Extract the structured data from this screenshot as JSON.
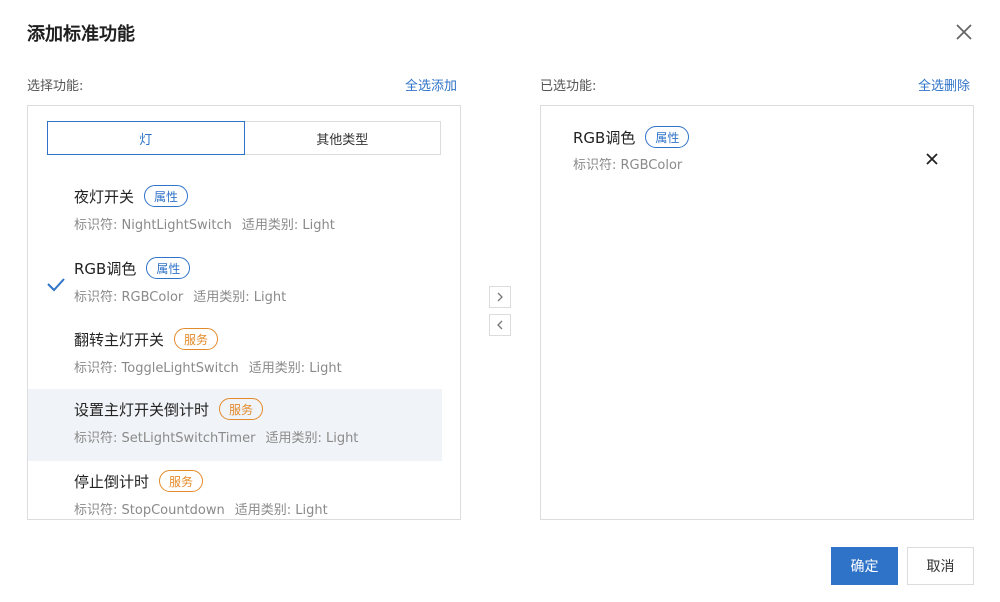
{
  "dialog": {
    "title": "添加标准功能"
  },
  "left": {
    "label": "选择功能:",
    "select_all": "全选添加",
    "tabs": [
      {
        "label": "灯",
        "active": true
      },
      {
        "label": "其他类型",
        "active": false
      }
    ],
    "items": [
      {
        "name": "夜灯开关",
        "badge": "属性",
        "badge_type": "attr",
        "id_label": "标识符: NightLightSwitch",
        "category_label": "适用类别: Light",
        "checked": false,
        "hovered": false
      },
      {
        "name": "RGB调色",
        "badge": "属性",
        "badge_type": "attr",
        "id_label": "标识符: RGBColor",
        "category_label": "适用类别: Light",
        "checked": true,
        "hovered": false
      },
      {
        "name": "翻转主灯开关",
        "badge": "服务",
        "badge_type": "service",
        "id_label": "标识符: ToggleLightSwitch",
        "category_label": "适用类别: Light",
        "checked": false,
        "hovered": false
      },
      {
        "name": "设置主灯开关倒计时",
        "badge": "服务",
        "badge_type": "service",
        "id_label": "标识符: SetLightSwitchTimer",
        "category_label": "适用类别: Light",
        "checked": false,
        "hovered": true
      },
      {
        "name": "停止倒计时",
        "badge": "服务",
        "badge_type": "service",
        "id_label": "标识符: StopCountdown",
        "category_label": "适用类别: Light",
        "checked": false,
        "hovered": false
      }
    ]
  },
  "right": {
    "label": "已选功能:",
    "delete_all": "全选删除",
    "items": [
      {
        "name": "RGB调色",
        "badge": "属性",
        "badge_type": "attr",
        "id_label": "标识符: RGBColor"
      }
    ]
  },
  "footer": {
    "confirm": "确定",
    "cancel": "取消"
  },
  "colors": {
    "accent": "#2f73c8",
    "service": "#e38a2a",
    "hover_bg": "#f0f3f7"
  }
}
